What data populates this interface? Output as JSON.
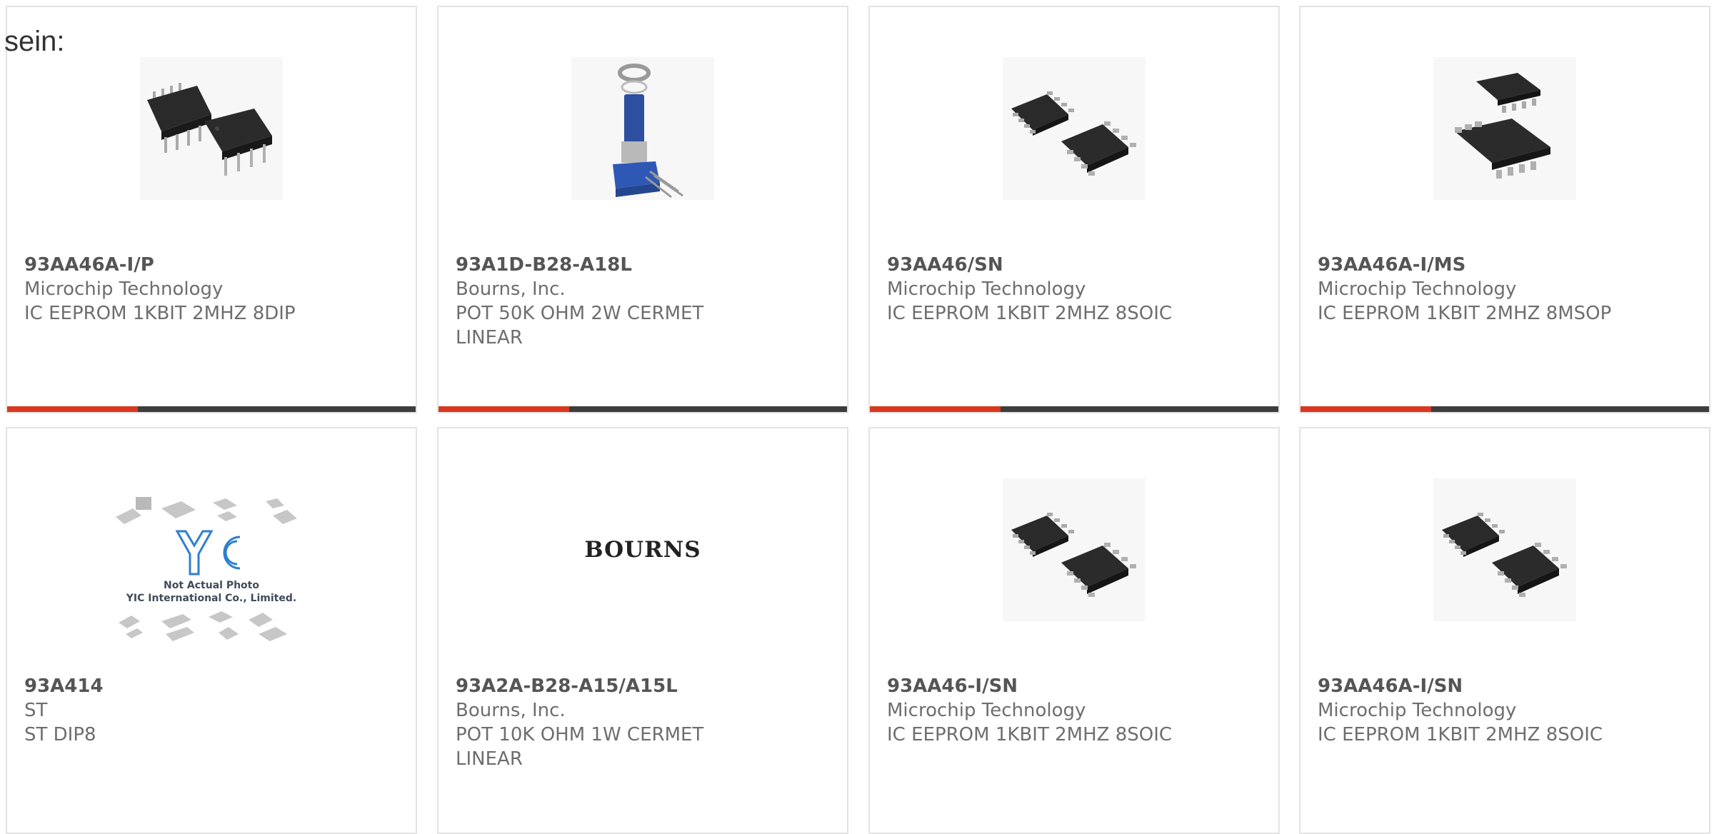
{
  "page": {
    "lead_text": "sein:"
  },
  "products": [
    {
      "part_number": "93AA46A-I/P",
      "manufacturer": "Microchip Technology",
      "description": "IC EEPROM 1KBIT 2MHZ 8DIP",
      "image": "dip8-ic-icon"
    },
    {
      "part_number": "93A1D-B28-A18L",
      "manufacturer": "Bourns, Inc.",
      "description": "POT 50K OHM 2W CERMET LINEAR",
      "image": "potentiometer-icon"
    },
    {
      "part_number": "93AA46/SN",
      "manufacturer": "Microchip Technology",
      "description": "IC EEPROM 1KBIT 2MHZ 8SOIC",
      "image": "soic8-ic-icon"
    },
    {
      "part_number": "93AA46A-I/MS",
      "manufacturer": "Microchip Technology",
      "description": "IC EEPROM 1KBIT 2MHZ 8MSOP",
      "image": "msop8-ic-icon"
    },
    {
      "part_number": "93A414",
      "manufacturer": "ST",
      "description": "ST DIP8",
      "image": "placeholder-photo",
      "placeholder": {
        "line1": "Not Actual Photo",
        "line2": "YIC International Co., Limited."
      }
    },
    {
      "part_number": "93A2A-B28-A15/A15L",
      "manufacturer": "Bourns, Inc.",
      "description": "POT 10K OHM 1W CERMET LINEAR",
      "image": "bourns-logo",
      "logo_text": "BOURNS"
    },
    {
      "part_number": "93AA46-I/SN",
      "manufacturer": "Microchip Technology",
      "description": "IC EEPROM 1KBIT 2MHZ 8SOIC",
      "image": "soic8-ic-icon"
    },
    {
      "part_number": "93AA46A-I/SN",
      "manufacturer": "Microchip Technology",
      "description": "IC EEPROM 1KBIT 2MHZ 8SOIC",
      "image": "soic8-ic-icon"
    }
  ],
  "colors": {
    "accent": "#d9381e",
    "bar": "#3d3d3d",
    "border": "#e3e3e3"
  }
}
